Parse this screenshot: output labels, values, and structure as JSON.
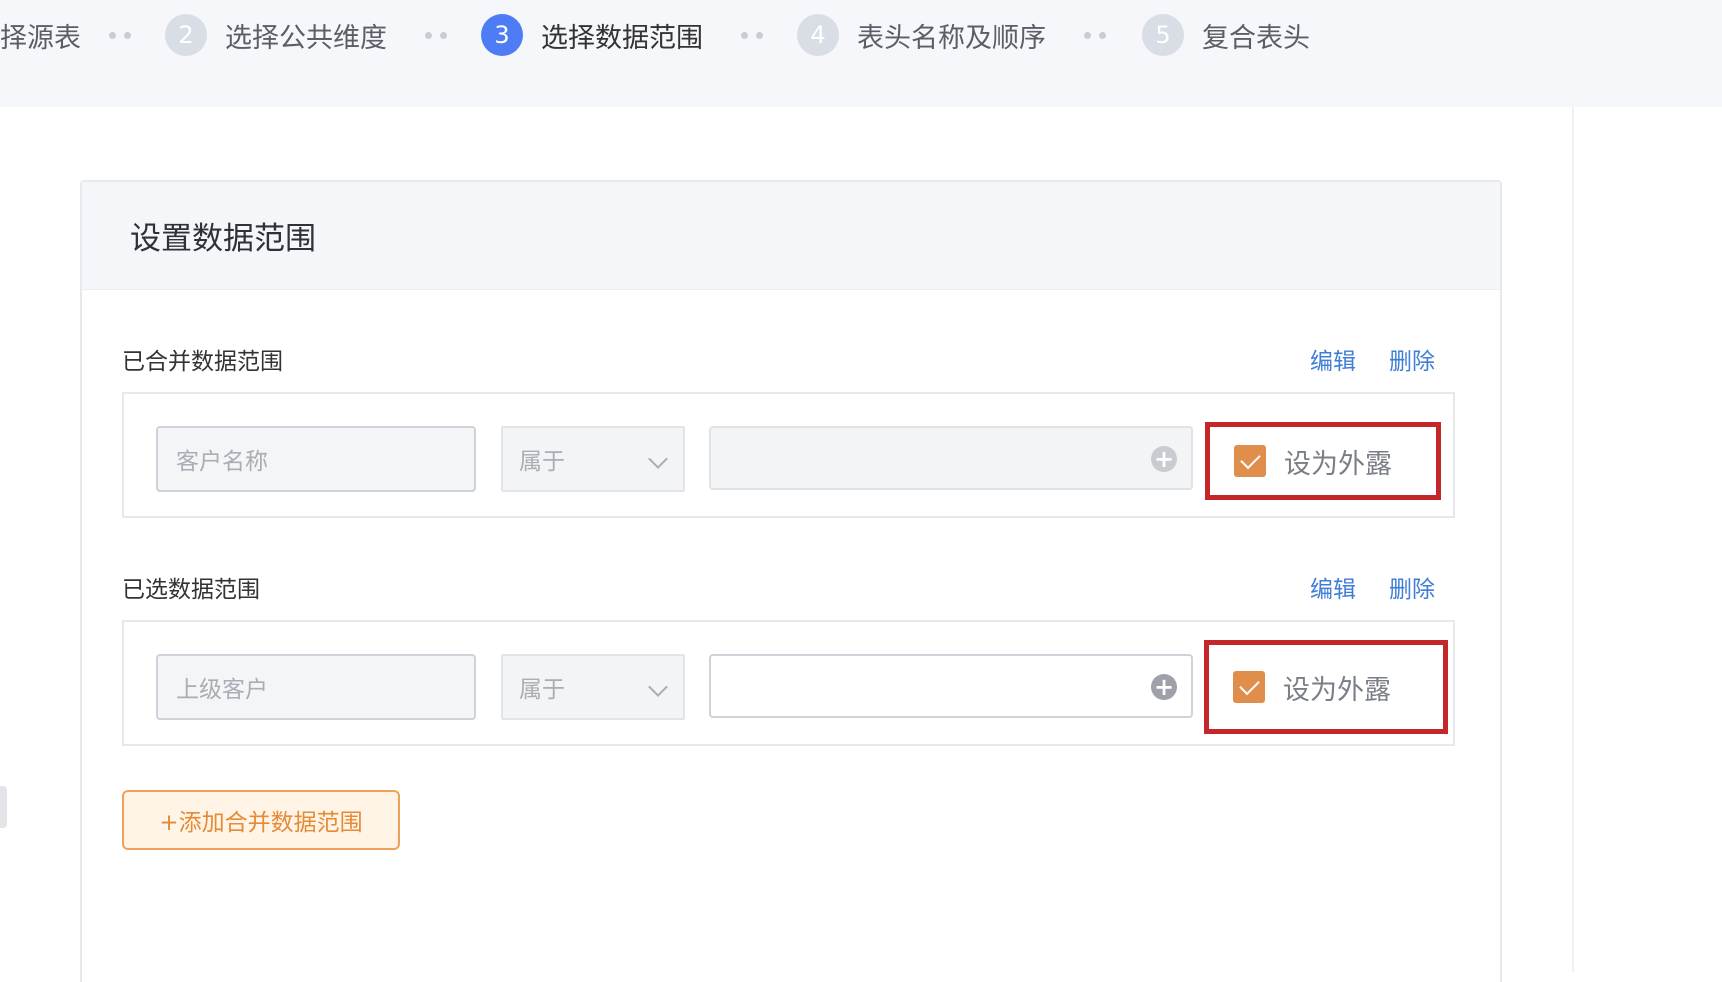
{
  "steps": [
    {
      "num": "",
      "label": "择源表"
    },
    {
      "num": "2",
      "label": "选择公共维度"
    },
    {
      "num": "3",
      "label": "选择数据范围"
    },
    {
      "num": "4",
      "label": "表头名称及顺序"
    },
    {
      "num": "5",
      "label": "复合表头"
    }
  ],
  "active_step": 3,
  "panel": {
    "title": "设置数据范围",
    "merged_section": {
      "title": "已合并数据范围",
      "edit": "编辑",
      "delete": "删除",
      "field_placeholder": "客户名称",
      "operator": "属于",
      "expose_label": "设为外露",
      "expose_checked": true
    },
    "selected_section": {
      "title": "已选数据范围",
      "edit": "编辑",
      "delete": "删除",
      "field_placeholder": "上级客户",
      "operator": "属于",
      "expose_label": "设为外露",
      "expose_checked": true
    },
    "add_button": "+添加合并数据范围"
  },
  "colors": {
    "active_step": "#4d7cf5",
    "link": "#3f7ed6",
    "checkbox": "#e08e4c",
    "highlight_border": "#c4262a",
    "add_button": "#e58a35"
  }
}
